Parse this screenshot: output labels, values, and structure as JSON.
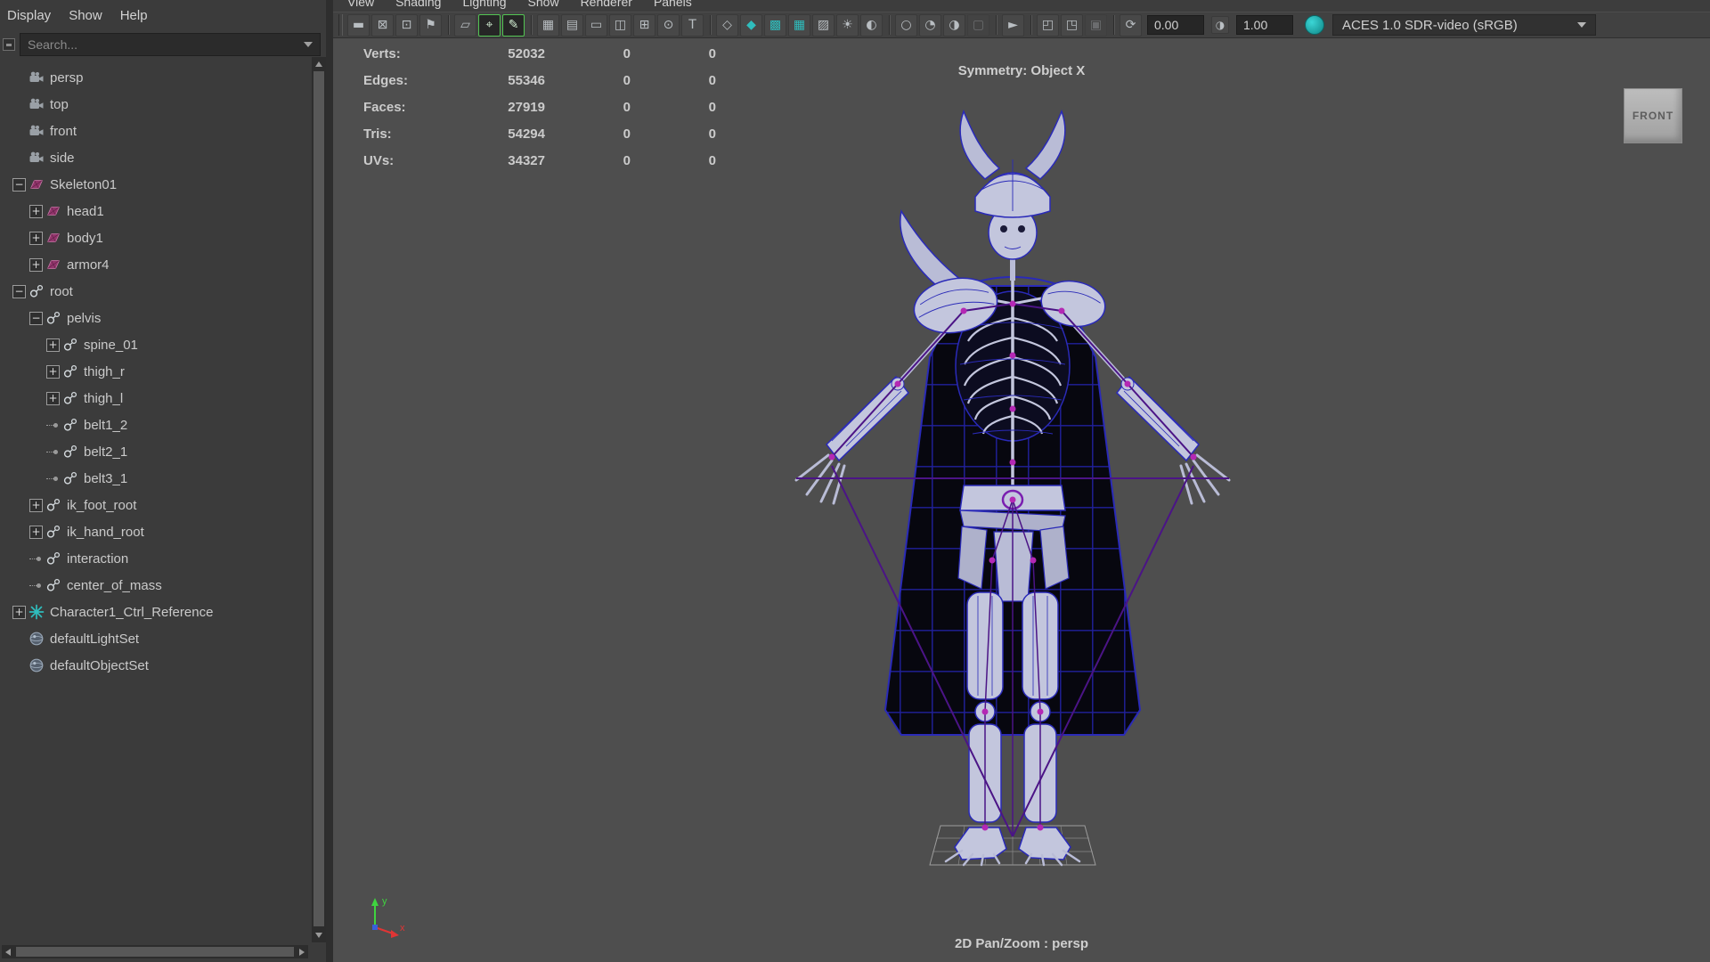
{
  "outliner": {
    "menus": [
      "Display",
      "Show",
      "Help"
    ],
    "search": {
      "placeholder": "Search..."
    },
    "items": [
      {
        "label": "persp",
        "icon": "camera",
        "depth": 0,
        "expander": "none"
      },
      {
        "label": "top",
        "icon": "camera",
        "depth": 0,
        "expander": "none"
      },
      {
        "label": "front",
        "icon": "camera",
        "depth": 0,
        "expander": "none"
      },
      {
        "label": "side",
        "icon": "camera",
        "depth": 0,
        "expander": "none"
      },
      {
        "label": "Skeleton01",
        "icon": "mesh",
        "depth": 0,
        "expander": "minus"
      },
      {
        "label": "head1",
        "icon": "mesh",
        "depth": 1,
        "expander": "plus"
      },
      {
        "label": "body1",
        "icon": "mesh",
        "depth": 1,
        "expander": "plus"
      },
      {
        "label": "armor4",
        "icon": "mesh",
        "depth": 1,
        "expander": "plus"
      },
      {
        "label": "root",
        "icon": "joint",
        "depth": 0,
        "expander": "minus"
      },
      {
        "label": "pelvis",
        "icon": "joint",
        "depth": 1,
        "expander": "minus"
      },
      {
        "label": "spine_01",
        "icon": "joint",
        "depth": 2,
        "expander": "plus"
      },
      {
        "label": "thigh_r",
        "icon": "joint",
        "depth": 2,
        "expander": "plus"
      },
      {
        "label": "thigh_l",
        "icon": "joint",
        "depth": 2,
        "expander": "plus"
      },
      {
        "label": "belt1_2",
        "icon": "joint",
        "depth": 2,
        "expander": "leaf"
      },
      {
        "label": "belt2_1",
        "icon": "joint",
        "depth": 2,
        "expander": "leaf"
      },
      {
        "label": "belt3_1",
        "icon": "joint",
        "depth": 2,
        "expander": "leaf"
      },
      {
        "label": "ik_foot_root",
        "icon": "joint",
        "depth": 1,
        "expander": "plus"
      },
      {
        "label": "ik_hand_root",
        "icon": "joint",
        "depth": 1,
        "expander": "plus"
      },
      {
        "label": "interaction",
        "icon": "joint",
        "depth": 1,
        "expander": "leaf"
      },
      {
        "label": "center_of_mass",
        "icon": "joint",
        "depth": 1,
        "expander": "leaf"
      },
      {
        "label": "Character1_Ctrl_Reference",
        "icon": "asterisk",
        "depth": 0,
        "expander": "plus"
      },
      {
        "label": "defaultLightSet",
        "icon": "set",
        "depth": 0,
        "expander": "none"
      },
      {
        "label": "defaultObjectSet",
        "icon": "set",
        "depth": 0,
        "expander": "none"
      }
    ]
  },
  "viewport": {
    "menus": [
      "View",
      "Shading",
      "Lighting",
      "Show",
      "Renderer",
      "Panels"
    ],
    "toolbar": {
      "buttons": [
        {
          "name": "select-camera",
          "glyph": "▬"
        },
        {
          "name": "lock-camera",
          "glyph": "⊠"
        },
        {
          "name": "camera-attributes",
          "glyph": "⊡"
        },
        {
          "name": "bookmark",
          "glyph": "⚑"
        },
        {
          "sep": true
        },
        {
          "name": "image-plane",
          "glyph": "▱"
        },
        {
          "name": "2d-pan-zoom",
          "glyph": "⌖",
          "state": "active"
        },
        {
          "name": "grease-pencil",
          "glyph": "✎",
          "state": "active"
        },
        {
          "sep": true
        },
        {
          "name": "grid",
          "glyph": "▦"
        },
        {
          "name": "film-gate",
          "glyph": "▤"
        },
        {
          "name": "resolution-gate",
          "glyph": "▭"
        },
        {
          "name": "gate-mask",
          "glyph": "◫"
        },
        {
          "name": "field-chart",
          "glyph": "⊞"
        },
        {
          "name": "safe-action",
          "glyph": "⊙"
        },
        {
          "name": "safe-title",
          "glyph": "T"
        },
        {
          "sep": true
        },
        {
          "name": "wireframe",
          "glyph": "◇"
        },
        {
          "name": "shaded",
          "glyph": "◆",
          "tint": "teal"
        },
        {
          "name": "textured",
          "glyph": "▩",
          "tint": "teal"
        },
        {
          "name": "wireframe-on-shaded",
          "glyph": "▦",
          "tint": "teal"
        },
        {
          "name": "xray",
          "glyph": "▨"
        },
        {
          "name": "default-lighting",
          "glyph": "☀"
        },
        {
          "name": "shadows",
          "glyph": "◐"
        },
        {
          "sep": true
        },
        {
          "name": "occlusion",
          "glyph": "○"
        },
        {
          "name": "motion-blur",
          "glyph": "◔"
        },
        {
          "name": "anti-aliasing",
          "glyph": "◑"
        },
        {
          "name": "depth-of-field",
          "glyph": "▢",
          "state": "disabled"
        },
        {
          "sep": true
        },
        {
          "name": "isolate-select",
          "glyph": "►"
        },
        {
          "sep": true
        },
        {
          "name": "tear-off-copy",
          "glyph": "◰"
        },
        {
          "name": "tear-off",
          "glyph": "◳"
        },
        {
          "name": "snapshot",
          "glyph": "▣",
          "state": "disabled"
        },
        {
          "sep": true
        },
        {
          "name": "exposure-icon",
          "glyph": "⟳"
        }
      ],
      "exposure": "0.00",
      "gamma_icon_glyph": "◑",
      "gamma": "1.00",
      "colorspace": "ACES 1.0 SDR-video (sRGB)"
    },
    "hud": {
      "stats": [
        {
          "label": "Verts:",
          "count": "52032",
          "c2": "0",
          "c3": "0"
        },
        {
          "label": "Edges:",
          "count": "55346",
          "c2": "0",
          "c3": "0"
        },
        {
          "label": "Faces:",
          "count": "27919",
          "c2": "0",
          "c3": "0"
        },
        {
          "label": "Tris:",
          "count": "54294",
          "c2": "0",
          "c3": "0"
        },
        {
          "label": "UVs:",
          "count": "34327",
          "c2": "0",
          "c3": "0"
        }
      ],
      "symmetry": "Symmetry: Object X",
      "pan_zoom": "2D Pan/Zoom : persp",
      "view_cube": "FRONT",
      "axis": {
        "y": "y",
        "x": "x"
      }
    }
  },
  "colors": {
    "viewport_bg": "#4e4e4e",
    "panel_bg": "#3b3b3b",
    "wire_blue": "#2a2ab8",
    "bone_fill": "#c3c6dd",
    "ik_purple": "#4b1486",
    "joint_magenta": "#b428b4",
    "active_green": "#52c452",
    "teal": "#2fbdbd"
  }
}
